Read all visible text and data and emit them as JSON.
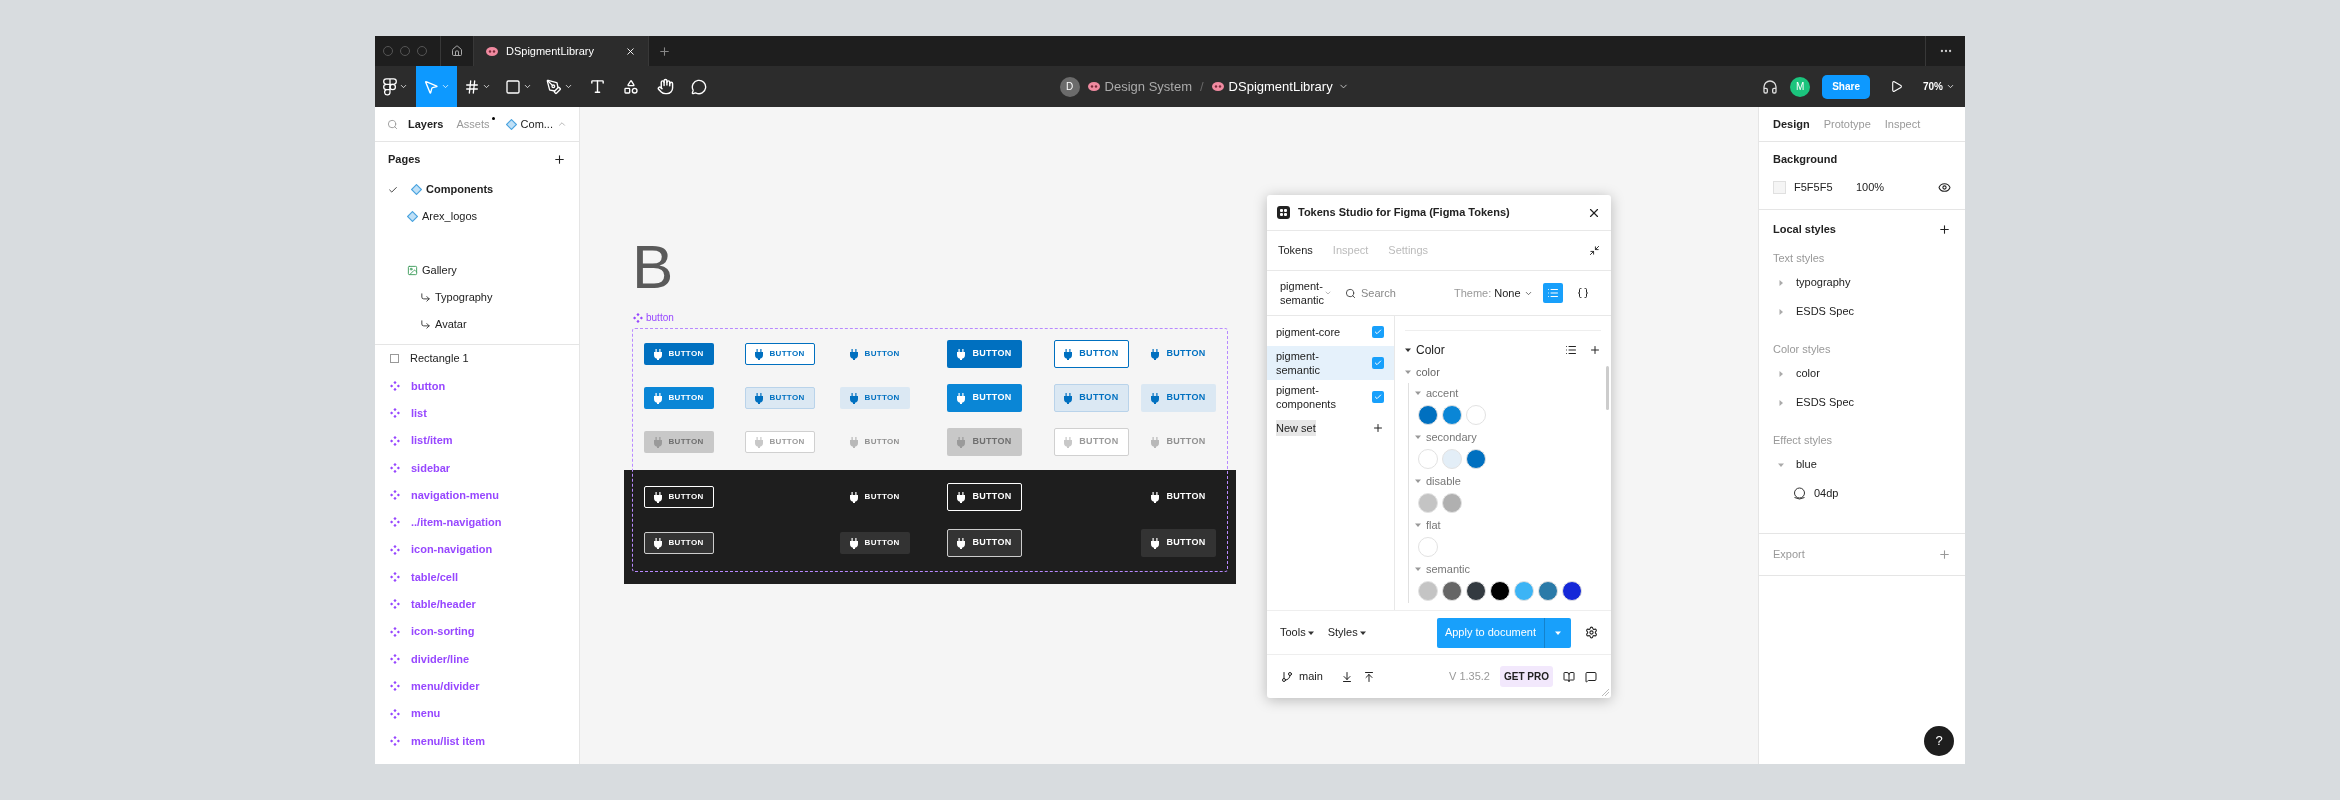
{
  "tab_bar": {
    "tabs": [
      {
        "title": "DSpigmentLibrary",
        "selected": true
      }
    ]
  },
  "toolbar": {
    "tools": [
      {
        "kind": "main-menu",
        "selected": false,
        "dropdown": true
      },
      {
        "kind": "move",
        "selected": true,
        "dropdown": true
      },
      {
        "kind": "frame",
        "selected": false,
        "dropdown": true
      },
      {
        "kind": "shape",
        "selected": false,
        "dropdown": true
      },
      {
        "kind": "pen",
        "selected": false,
        "dropdown": true
      },
      {
        "kind": "text",
        "selected": false,
        "dropdown": false
      },
      {
        "kind": "resources",
        "selected": false,
        "dropdown": false
      },
      {
        "kind": "hand",
        "selected": false,
        "dropdown": false
      },
      {
        "kind": "comment",
        "selected": false,
        "dropdown": false
      }
    ],
    "team_avatar": "D",
    "team": "Design System",
    "separator": "/",
    "file": "DSpigmentLibrary",
    "user_avatar": "M",
    "share": "Share",
    "zoom": "70%"
  },
  "left_panel": {
    "tabs": [
      {
        "label": "Layers",
        "selected": true,
        "has_update": false
      },
      {
        "label": "Assets",
        "selected": false,
        "has_update": true
      }
    ],
    "page_picker": "Com...",
    "pages_title": "Pages",
    "pages": [
      {
        "name": "Components",
        "kind": "component",
        "selected": true
      },
      {
        "name": "Arex_logos",
        "kind": "component",
        "selected": false
      },
      {
        "kind": "blank",
        "selected": false
      },
      {
        "name": "Gallery",
        "kind": "image",
        "selected": false
      },
      {
        "name": "Typography",
        "kind": "link",
        "selected": false
      },
      {
        "name": "Avatar",
        "kind": "link",
        "selected": false
      }
    ],
    "layers": [
      {
        "name": "Rectangle 1",
        "kind": "rectangle"
      },
      {
        "name": "button",
        "kind": "component"
      },
      {
        "name": "list",
        "kind": "component"
      },
      {
        "name": "list/item",
        "kind": "component"
      },
      {
        "name": "sidebar",
        "kind": "component"
      },
      {
        "name": "navigation-menu",
        "kind": "component"
      },
      {
        "name": "../item-navigation",
        "kind": "component"
      },
      {
        "name": "icon-navigation",
        "kind": "component"
      },
      {
        "name": "table/cell",
        "kind": "component"
      },
      {
        "name": "table/header",
        "kind": "component"
      },
      {
        "name": "icon-sorting",
        "kind": "component"
      },
      {
        "name": "divider/line",
        "kind": "component"
      },
      {
        "name": "menu/divider",
        "kind": "component"
      },
      {
        "name": "menu",
        "kind": "component"
      },
      {
        "name": "menu/list item",
        "kind": "component"
      }
    ]
  },
  "canvas": {
    "section_letter": "B",
    "frame_label": "button",
    "light_rows": [
      [
        {
          "kind": "primary",
          "large": false,
          "label": "BUTTON"
        },
        {
          "kind": "outline",
          "large": false,
          "label": "BUTTON"
        },
        {
          "kind": "text",
          "large": false,
          "label": "BUTTON"
        },
        {
          "kind": "primary",
          "large": true,
          "label": "BUTTON"
        },
        {
          "kind": "outline",
          "large": true,
          "label": "BUTTON"
        },
        {
          "kind": "text",
          "large": true,
          "label": "BUTTON"
        }
      ],
      [
        {
          "kind": "primary_bright",
          "large": false,
          "label": "BUTTON"
        },
        {
          "kind": "secondary",
          "large": false,
          "label": "BUTTON"
        },
        {
          "kind": "secondary_flat",
          "large": false,
          "label": "BUTTON"
        },
        {
          "kind": "primary_bright",
          "large": true,
          "label": "BUTTON"
        },
        {
          "kind": "secondary",
          "large": true,
          "label": "BUTTON"
        },
        {
          "kind": "secondary_flat",
          "large": true,
          "label": "BUTTON"
        }
      ],
      [
        {
          "kind": "disabled_fill",
          "large": false,
          "label": "BUTTON"
        },
        {
          "kind": "disabled_outline",
          "large": false,
          "label": "BUTTON"
        },
        {
          "kind": "disabled_text",
          "large": false,
          "label": "BUTTON"
        },
        {
          "kind": "disabled_fill",
          "large": true,
          "label": "BUTTON"
        },
        {
          "kind": "disabled_outline",
          "large": true,
          "label": "BUTTON"
        },
        {
          "kind": "disabled_text",
          "large": true,
          "label": "BUTTON"
        }
      ]
    ],
    "dark_rows": [
      [
        {
          "kind": "dark_outline",
          "large": false,
          "label": "BUTTON"
        },
        null,
        {
          "kind": "dark_text",
          "large": false,
          "label": "BUTTON"
        },
        {
          "kind": "dark_outline",
          "large": true,
          "label": "BUTTON"
        },
        null,
        {
          "kind": "dark_text",
          "large": true,
          "label": "BUTTON"
        }
      ],
      [
        {
          "kind": "dark_outline_fill",
          "large": false,
          "label": "BUTTON"
        },
        null,
        {
          "kind": "dark_fill",
          "large": false,
          "label": "BUTTON"
        },
        {
          "kind": "dark_outline_fill",
          "large": true,
          "label": "BUTTON"
        },
        null,
        {
          "kind": "dark_fill",
          "large": true,
          "label": "BUTTON"
        }
      ]
    ]
  },
  "plugin": {
    "title": "Tokens Studio for Figma (Figma Tokens)",
    "tabs": [
      {
        "label": "Tokens",
        "selected": true
      },
      {
        "label": "Inspect",
        "selected": false
      },
      {
        "label": "Settings",
        "selected": false
      }
    ],
    "set_picker": "pigment-semantic",
    "search_placeholder": "Search",
    "theme_label": "Theme:",
    "theme_value": "None",
    "views": [
      {
        "kind": "list",
        "selected": true
      },
      {
        "kind": "json",
        "selected": false
      }
    ],
    "sets": [
      {
        "name": "pigment-core",
        "checked": true,
        "selected": false
      },
      {
        "name": "pigment-semantic",
        "checked": true,
        "selected": true
      },
      {
        "name": "pigment-components",
        "checked": true,
        "selected": false
      }
    ],
    "new_set": "New set",
    "token_type": {
      "title": "Color",
      "expanded": true,
      "group": {
        "name": "color",
        "expanded": true,
        "children": [
          {
            "name": "accent",
            "expanded": true,
            "swatches": [
              {
                "color": "#0070c0"
              },
              {
                "color": "#0a86d6"
              },
              {
                "color": "#ffffff"
              }
            ]
          },
          {
            "name": "secondary",
            "expanded": true,
            "swatches": [
              {
                "color": "#ffffff"
              },
              {
                "color": "#e3eef7"
              },
              {
                "color": "#0070c0"
              }
            ]
          },
          {
            "name": "disable",
            "expanded": true,
            "swatches": [
              {
                "color": "#c4c4c4"
              },
              {
                "color": "#b0b0b0"
              }
            ]
          },
          {
            "name": "flat",
            "expanded": true,
            "swatches": [
              {
                "color": "#ffffff"
              }
            ]
          },
          {
            "name": "semantic",
            "expanded": true,
            "swatches": [
              {
                "color": "#c4c4c4"
              },
              {
                "color": "#666666"
              },
              {
                "color": "#333a40"
              },
              {
                "color": "#000000"
              },
              {
                "color": "#3cb4f5"
              },
              {
                "color": "#2a7aa8"
              },
              {
                "color": "#1428d8"
              }
            ]
          }
        ]
      }
    },
    "tools": "Tools",
    "styles": "Styles",
    "apply": "Apply to document",
    "branch": "main",
    "version": "V 1.35.2",
    "pro": "GET PRO"
  },
  "right_panel": {
    "tabs": [
      {
        "label": "Design",
        "selected": true
      },
      {
        "label": "Prototype",
        "selected": false
      },
      {
        "label": "Inspect",
        "selected": false
      }
    ],
    "background_title": "Background",
    "background_hex": "F5F5F5",
    "background_opacity": "100%",
    "local_styles_title": "Local styles",
    "style_groups": [
      {
        "title": "Text styles",
        "items": [
          {
            "name": "typography",
            "expanded": false
          },
          {
            "name": "ESDS Spec",
            "expanded": false
          }
        ]
      },
      {
        "title": "Color styles",
        "items": [
          {
            "name": "color",
            "expanded": false
          },
          {
            "name": "ESDS Spec",
            "expanded": false
          }
        ]
      },
      {
        "title": "Effect styles",
        "items": [
          {
            "name": "blue",
            "expanded": true,
            "children": [
              {
                "name": "04dp"
              }
            ]
          }
        ]
      }
    ],
    "export_title": "Export"
  },
  "help": "?"
}
